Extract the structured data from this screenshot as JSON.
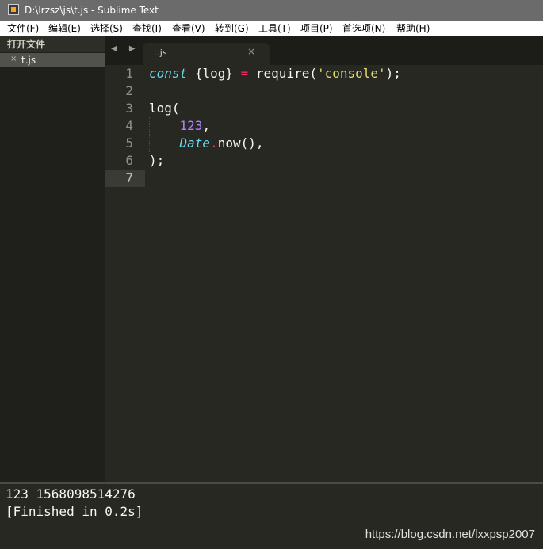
{
  "window": {
    "title": "D:\\lrzsz\\js\\t.js - Sublime Text"
  },
  "menubar": {
    "items": [
      "文件(F)",
      "编辑(E)",
      "选择(S)",
      "查找(I)",
      "查看(V)",
      "转到(G)",
      "工具(T)",
      "项目(P)",
      "首选项(N)",
      "帮助(H)"
    ]
  },
  "sidebar": {
    "header": "打开文件",
    "open_files": [
      {
        "name": "t.js",
        "close_glyph": "×"
      }
    ]
  },
  "tabs": {
    "nav_arrows": "◀ ▶",
    "items": [
      {
        "label": "t.js",
        "close_glyph": "×",
        "active": true
      }
    ]
  },
  "editor": {
    "current_line": 7,
    "lines": [
      {
        "num": "1"
      },
      {
        "num": "2"
      },
      {
        "num": "3"
      },
      {
        "num": "4"
      },
      {
        "num": "5"
      },
      {
        "num": "6"
      },
      {
        "num": "7"
      }
    ],
    "tokens": {
      "l1_const": "const",
      "l1_space1": " ",
      "l1_destructure": "{log}",
      "l1_space2": " ",
      "l1_eq": "=",
      "l1_space3": " ",
      "l1_require": "require(",
      "l1_str": "'console'",
      "l1_end": ");",
      "l3_log": "log(",
      "l4_indent": "    ",
      "l4_num": "123",
      "l4_comma": ",",
      "l5_indent": "    ",
      "l5_date": "Date",
      "l5_dot": ".",
      "l5_now": "now(),",
      "l6_close": ");"
    }
  },
  "output": {
    "lines": [
      "123 1568098514276",
      "[Finished in 0.2s]"
    ]
  },
  "watermark": {
    "text": "https://blog.csdn.net/lxxpsp2007"
  },
  "colors": {
    "background": "#272822",
    "keyword": "#66d9ef",
    "operator": "#f92672",
    "string": "#e6db74",
    "number": "#ae81ff",
    "text": "#f8f8f2"
  }
}
